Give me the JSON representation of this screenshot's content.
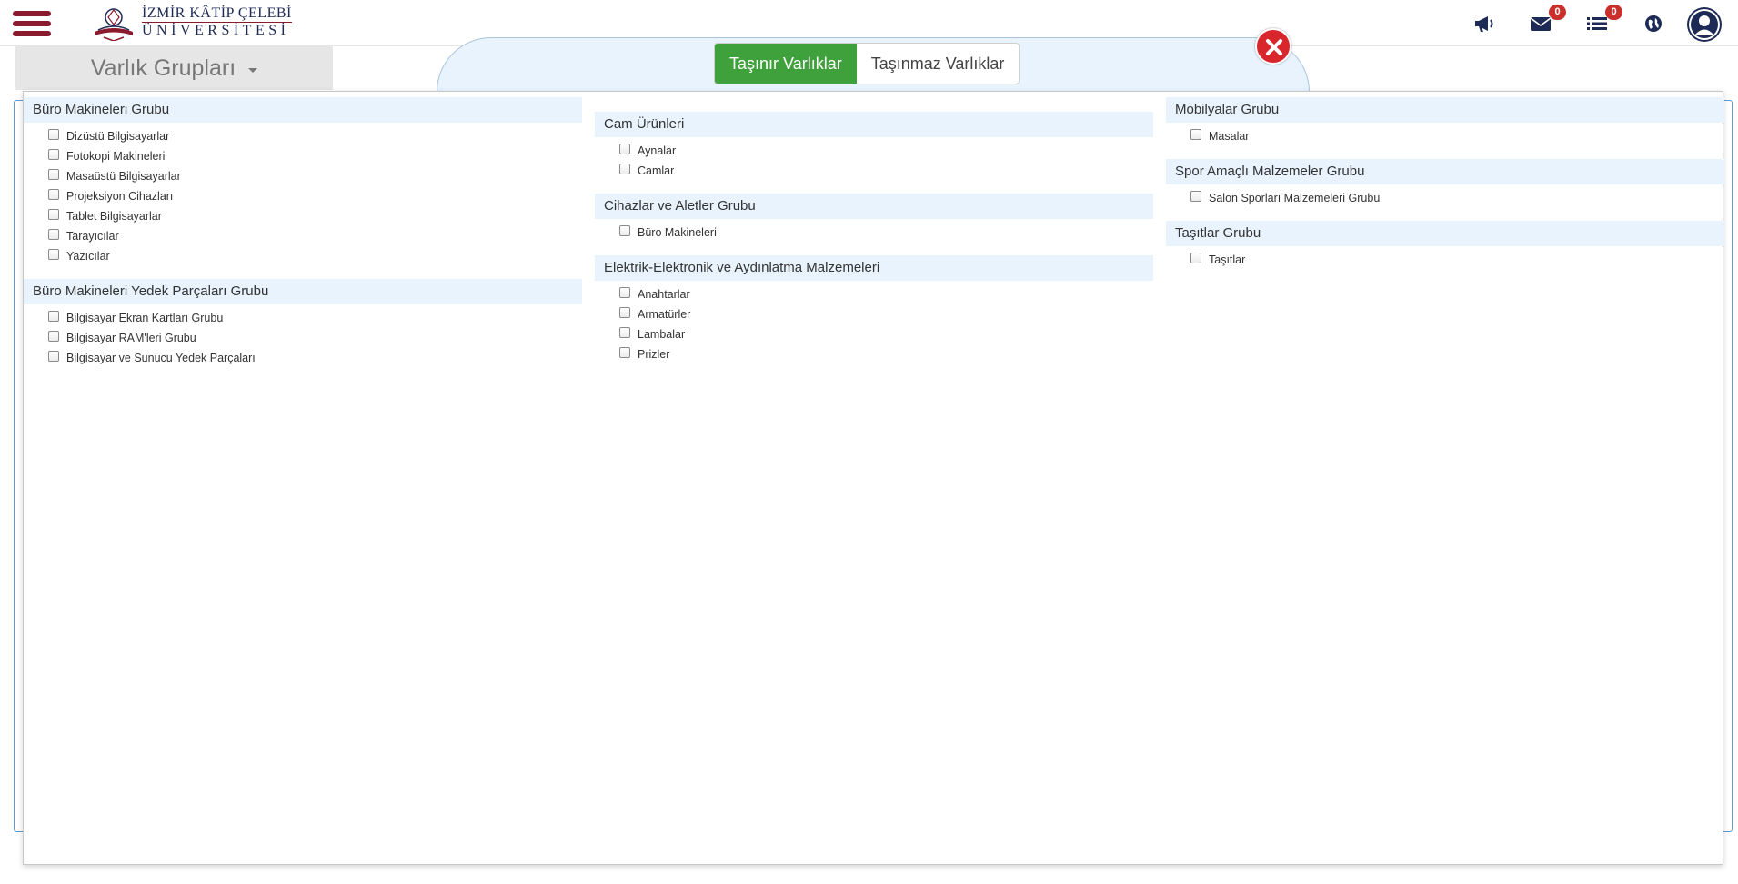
{
  "header": {
    "logo_line1": "İZMİR KÂTİP ÇELEBİ",
    "logo_line2": "ÜNİVERSİTESİ",
    "messages_badge": "0",
    "tasks_badge": "0"
  },
  "group_selector": {
    "label": "Varlık Grupları"
  },
  "tabs": [
    {
      "label": "Taşınır Varlıklar",
      "active": true
    },
    {
      "label": "Taşınmaz Varlıklar",
      "active": false
    }
  ],
  "columns": [
    {
      "groups": [
        {
          "title": "Büro Makineleri Grubu",
          "items": [
            "Dizüstü Bilgisayarlar",
            "Fotokopi Makineleri",
            "Masaüstü Bilgisayarlar",
            "Projeksiyon Cihazları",
            "Tablet Bilgisayarlar",
            "Tarayıcılar",
            "Yazıcılar"
          ]
        },
        {
          "title": "Büro Makineleri Yedek Parçaları Grubu",
          "items": [
            "Bilgisayar Ekran Kartları Grubu",
            "Bilgisayar RAM'leri Grubu",
            "Bilgisayar ve Sunucu Yedek Parçaları"
          ]
        }
      ]
    },
    {
      "groups": [
        {
          "title": "Cam Ürünleri",
          "items": [
            "Aynalar",
            "Camlar"
          ]
        },
        {
          "title": "Cihazlar ve Aletler Grubu",
          "items": [
            "Büro Makineleri"
          ]
        },
        {
          "title": "Elektrik-Elektronik ve Aydınlatma Malzemeleri",
          "items": [
            "Anahtarlar",
            "Armatürler",
            "Lambalar",
            "Prizler"
          ]
        }
      ]
    },
    {
      "groups": [
        {
          "title": "Mobilyalar Grubu",
          "items": [
            "Masalar"
          ]
        },
        {
          "title": "Spor Amaçlı Malzemeler Grubu",
          "items": [
            "Salon Sporları Malzemeleri Grubu"
          ]
        },
        {
          "title": "Taşıtlar Grubu",
          "items": [
            "Taşıtlar"
          ]
        }
      ]
    }
  ]
}
